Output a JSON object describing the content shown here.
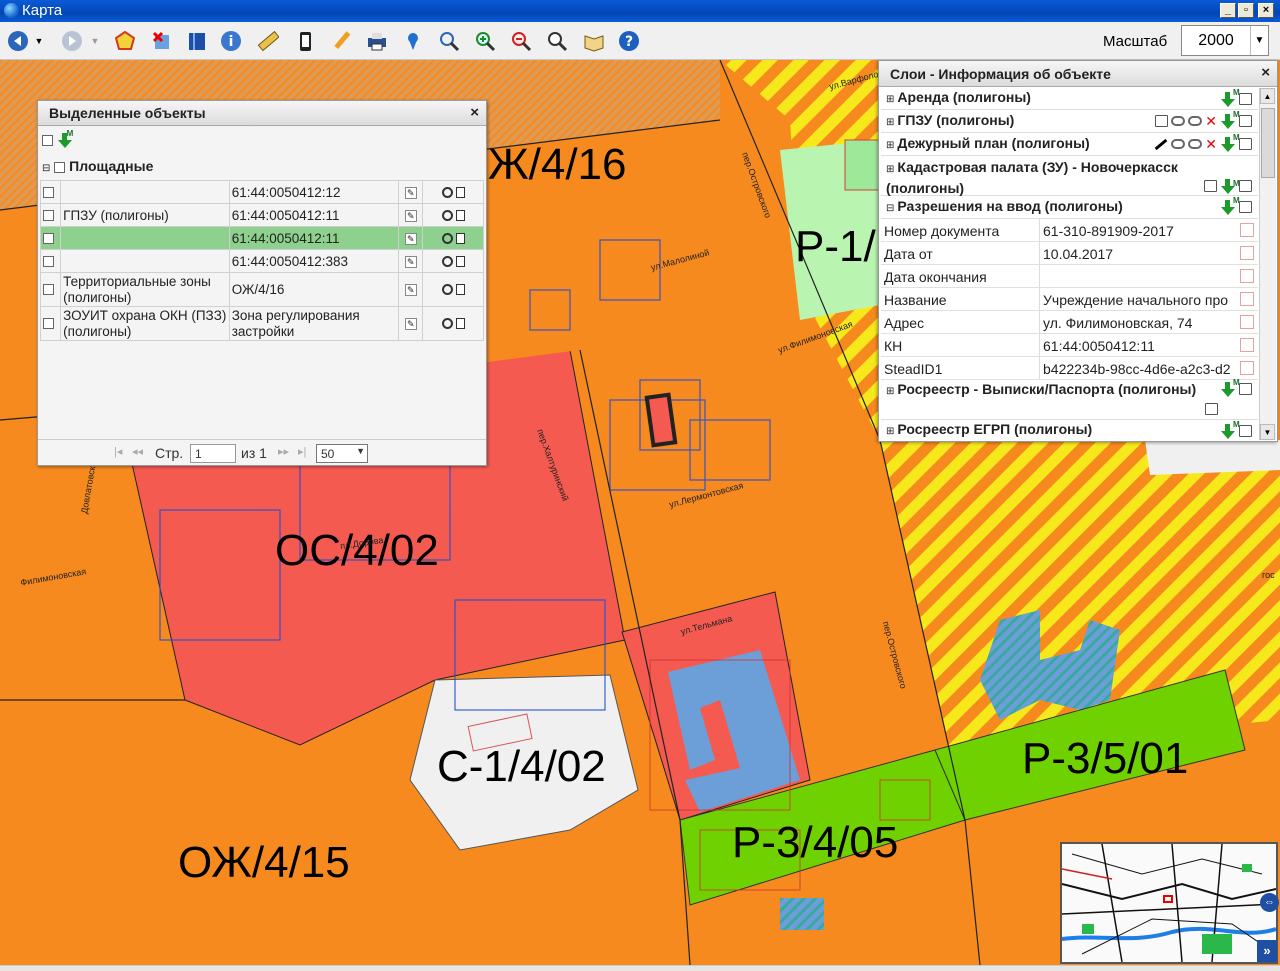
{
  "window": {
    "title": "Карта"
  },
  "toolbar": {
    "tools": [
      "back-arrow-icon",
      "dropdown-icon",
      "forward-arrow-icon",
      "dropdown-icon",
      "polygon-select-icon",
      "clear-selection-icon",
      "book-icon",
      "info-icon",
      "ruler-icon",
      "mobile-icon",
      "pencil-icon",
      "print-icon",
      "pin-icon",
      "zoom-extent-icon",
      "zoom-in-icon",
      "zoom-out-icon",
      "search-icon",
      "open-book-icon",
      "help-icon"
    ],
    "scale_label": "Масштаб",
    "scale_value": "2000"
  },
  "map": {
    "zones": [
      "Ж/4/16",
      "Р-1/",
      "ОС/4/02",
      "С-1/4/02",
      "ОЖ/4/15",
      "Р-3/4/05",
      "Р-3/5/01"
    ],
    "streets": [
      "пер.Островского",
      "ул.Малолиной",
      "ул.Филимоновская",
      "пер.Халтуринский",
      "ул.Лермонтовская",
      "пл.Дорова",
      "ул.Тельмана",
      "пер.Островского",
      "ул.Варфоломеева",
      "Филимоновская",
      "Довлатовский",
      "гос"
    ]
  },
  "selected_panel": {
    "title": "Выделенные объекты",
    "group_label": "Площадные",
    "rows": [
      {
        "layer": "",
        "value": "61:44:0050412:12"
      },
      {
        "layer": "ГПЗУ (полигоны)",
        "value": "61:44:0050412:11"
      },
      {
        "layer": "",
        "value": "61:44:0050412:11"
      },
      {
        "layer": "",
        "value": "61:44:0050412:383"
      },
      {
        "layer": "Территориальные зоны (полигоны)",
        "value": "ОЖ/4/16"
      },
      {
        "layer": "ЗОУИТ охрана ОКН (ПЗЗ) (полигоны)",
        "value": "Зона регулирования застройки"
      }
    ],
    "pager": {
      "page_label": "Стр.",
      "page_value": "1",
      "of_label": "из 1",
      "page_size": "50"
    }
  },
  "layer_panel": {
    "title": "Слои - Информация об объекте",
    "layers": [
      "Аренда (полигоны)",
      "ГПЗУ (полигоны)",
      "Дежурный план (полигоны)",
      "Кадастровая палата (ЗУ) - Новочеркасск (полигоны)",
      "Разрешения на ввод (полигоны)",
      "Росреестр - Выписки/Паспорта (полигоны)",
      "Росреестр ЕГРП (полигоны)"
    ],
    "properties": [
      {
        "name": "Номер документа",
        "value": "61-310-891909-2017"
      },
      {
        "name": "Дата от",
        "value": "10.04.2017"
      },
      {
        "name": "Дата окончания",
        "value": ""
      },
      {
        "name": "Название",
        "value": "Учреждение начального про"
      },
      {
        "name": "Адрес",
        "value": "ул. Филимоновская, 74"
      },
      {
        "name": "КН",
        "value": "61:44:0050412:11"
      },
      {
        "name": "SteadID1",
        "value": "b422234b-98cc-4d6e-a2c3-d2"
      }
    ]
  },
  "overview": {
    "toggle_label": "»"
  },
  "colors": {
    "zone_orange": "#f68a1e",
    "zone_red": "#f45a50",
    "zone_green": "#6fd200",
    "selected_row": "#8ed08e",
    "title_blue": "#0a5bd6"
  }
}
